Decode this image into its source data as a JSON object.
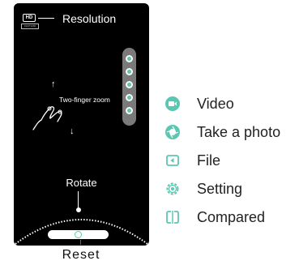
{
  "screen": {
    "hd_badge": "HD",
    "hd_sub": "1920*1080",
    "resolution_label": "Resolution",
    "zoom_label": "Two-finger zoom",
    "rotate_label": "Rotate",
    "arrow_up": "↑",
    "arrow_down": "↓"
  },
  "reset_label": "Reset",
  "legend": {
    "items": [
      {
        "icon": "video-icon",
        "label": "Video"
      },
      {
        "icon": "camera-shutter-icon",
        "label": "Take a photo"
      },
      {
        "icon": "file-icon",
        "label": "File"
      },
      {
        "icon": "gear-icon",
        "label": "Setting"
      },
      {
        "icon": "compare-icon",
        "label": "Compared"
      }
    ]
  },
  "colors": {
    "accent": "#5cc7b1",
    "background": "#000000",
    "rail": "#7a7a7a"
  }
}
